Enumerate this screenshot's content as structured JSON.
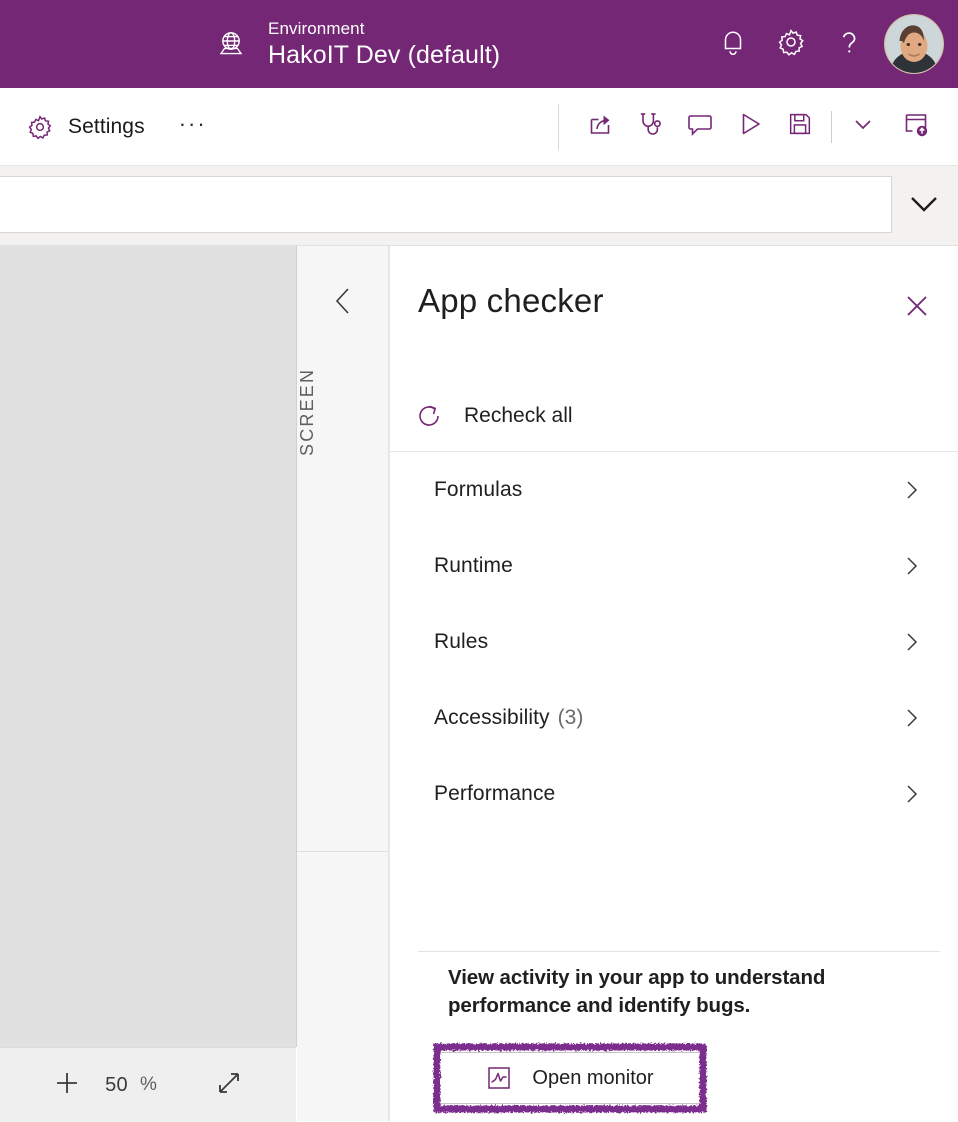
{
  "topbar": {
    "env_icon": "globe-environment-icon",
    "env_label": "Environment",
    "env_name": "HakoIT Dev (default)",
    "notifications_icon": "bell-icon",
    "settings_icon": "gear-icon",
    "help_icon": "question-mark-icon",
    "avatar_icon": "user-avatar",
    "background_color": "#742774"
  },
  "commandbar": {
    "settings_icon": "gear-icon",
    "settings_label": "Settings",
    "more_label": "···",
    "actions": [
      {
        "name": "share-button",
        "icon": "share-icon"
      },
      {
        "name": "app-checker-button",
        "icon": "stethoscope-icon"
      },
      {
        "name": "comments-button",
        "icon": "comment-icon"
      },
      {
        "name": "preview-button",
        "icon": "play-icon"
      },
      {
        "name": "save-button",
        "icon": "save-floppy-icon"
      },
      {
        "name": "save-options-button",
        "icon": "chevron-down-icon"
      },
      {
        "name": "publish-button",
        "icon": "publish-icon"
      }
    ],
    "accent_color": "#742774"
  },
  "formulabar": {
    "value": "",
    "placeholder": "",
    "expand_icon": "chevron-down-icon"
  },
  "canvas": {
    "zoom_value": "50",
    "zoom_unit": "%",
    "zoom_in_icon": "plus-icon",
    "fit_icon": "fit-to-screen-icon",
    "background_color": "#e1e1e1"
  },
  "screen_rail": {
    "collapse_icon": "chevron-left-icon",
    "title": "SCREEN"
  },
  "panel": {
    "title": "App checker",
    "close_icon": "close-x-icon",
    "recheck": {
      "icon": "refresh-icon",
      "label": "Recheck all"
    },
    "items": [
      {
        "label": "Formulas",
        "count": "",
        "chevron": "chevron-right-icon"
      },
      {
        "label": "Runtime",
        "count": "",
        "chevron": "chevron-right-icon"
      },
      {
        "label": "Rules",
        "count": "",
        "chevron": "chevron-right-icon"
      },
      {
        "label": "Accessibility",
        "count": "(3)",
        "chevron": "chevron-right-icon"
      },
      {
        "label": "Performance",
        "count": "",
        "chevron": "chevron-right-icon"
      }
    ],
    "monitor": {
      "description": "View activity in your app to understand performance and identify bugs.",
      "button_label": "Open monitor",
      "button_icon": "monitor-chart-icon",
      "highlight_color": "#7B2D8E"
    }
  }
}
